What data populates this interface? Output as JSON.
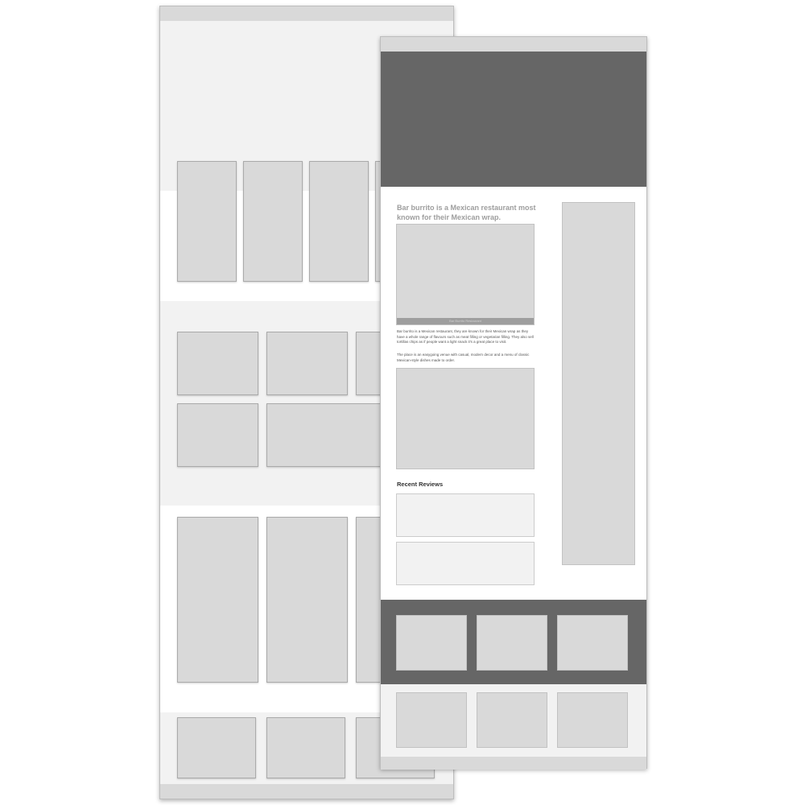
{
  "article": {
    "headline": "Bar burrito is a Mexican restaurant most known for their Mexican wrap.",
    "image_caption": "Bar Burrito Restaurant",
    "paragraphs": [
      "Bar burrito is a Mexican restaurant, they are known for their Mexican wrap as they have a whole range of flavours such as meat filling or vegetarian filling. They also sell tortillas chips as if people want a light snack it's a great place to visit.",
      "The place is an easygoing venue with casual, modern decor and a menu of classic Mexican-style dishes made to order."
    ]
  },
  "reviews": {
    "title": "Recent Reviews"
  },
  "colors": {
    "hero": "#666666",
    "placeholder": "#d9d9d9",
    "panel": "#f2f2f2",
    "footer": "#666666"
  }
}
